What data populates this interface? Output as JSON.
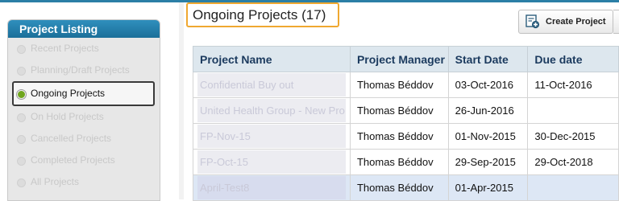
{
  "sidebar": {
    "title": "Project Listing",
    "items": [
      {
        "label": "Recent Projects"
      },
      {
        "label": "Planning/Draft Projects"
      },
      {
        "label": "Ongoing Projects"
      },
      {
        "label": "On Hold Projects"
      },
      {
        "label": "Cancelled Projects"
      },
      {
        "label": "Completed Projects"
      },
      {
        "label": "All Projects"
      }
    ],
    "active_index": 2
  },
  "page": {
    "title": "Ongoing Projects (17)"
  },
  "toolbar": {
    "create_label": "Create Project"
  },
  "table": {
    "columns": [
      "Project Name",
      "Project Manager",
      "Start Date",
      "Due date"
    ],
    "rows": [
      {
        "name": "Confidential Buy out",
        "manager": "Thomas Béddov",
        "start": "03-Oct-2016",
        "due": "11-Oct-2016"
      },
      {
        "name": "United Health Group - New Pro",
        "manager": "Thomas Béddov",
        "start": "26-Jun-2016",
        "due": ""
      },
      {
        "name": "FP-Nov-15",
        "manager": "Thomas Béddov",
        "start": "01-Nov-2015",
        "due": "30-Dec-2015"
      },
      {
        "name": "FP-Oct-15",
        "manager": "Thomas Béddov",
        "start": "29-Sep-2015",
        "due": "29-Oct-2018"
      },
      {
        "name": "April-Test8",
        "manager": "Thomas Béddov",
        "start": "01-Apr-2015",
        "due": ""
      }
    ]
  },
  "colors": {
    "accent": "#2b7fa6",
    "title_border": "#f0a830",
    "active_dot": "#6fa51e"
  }
}
